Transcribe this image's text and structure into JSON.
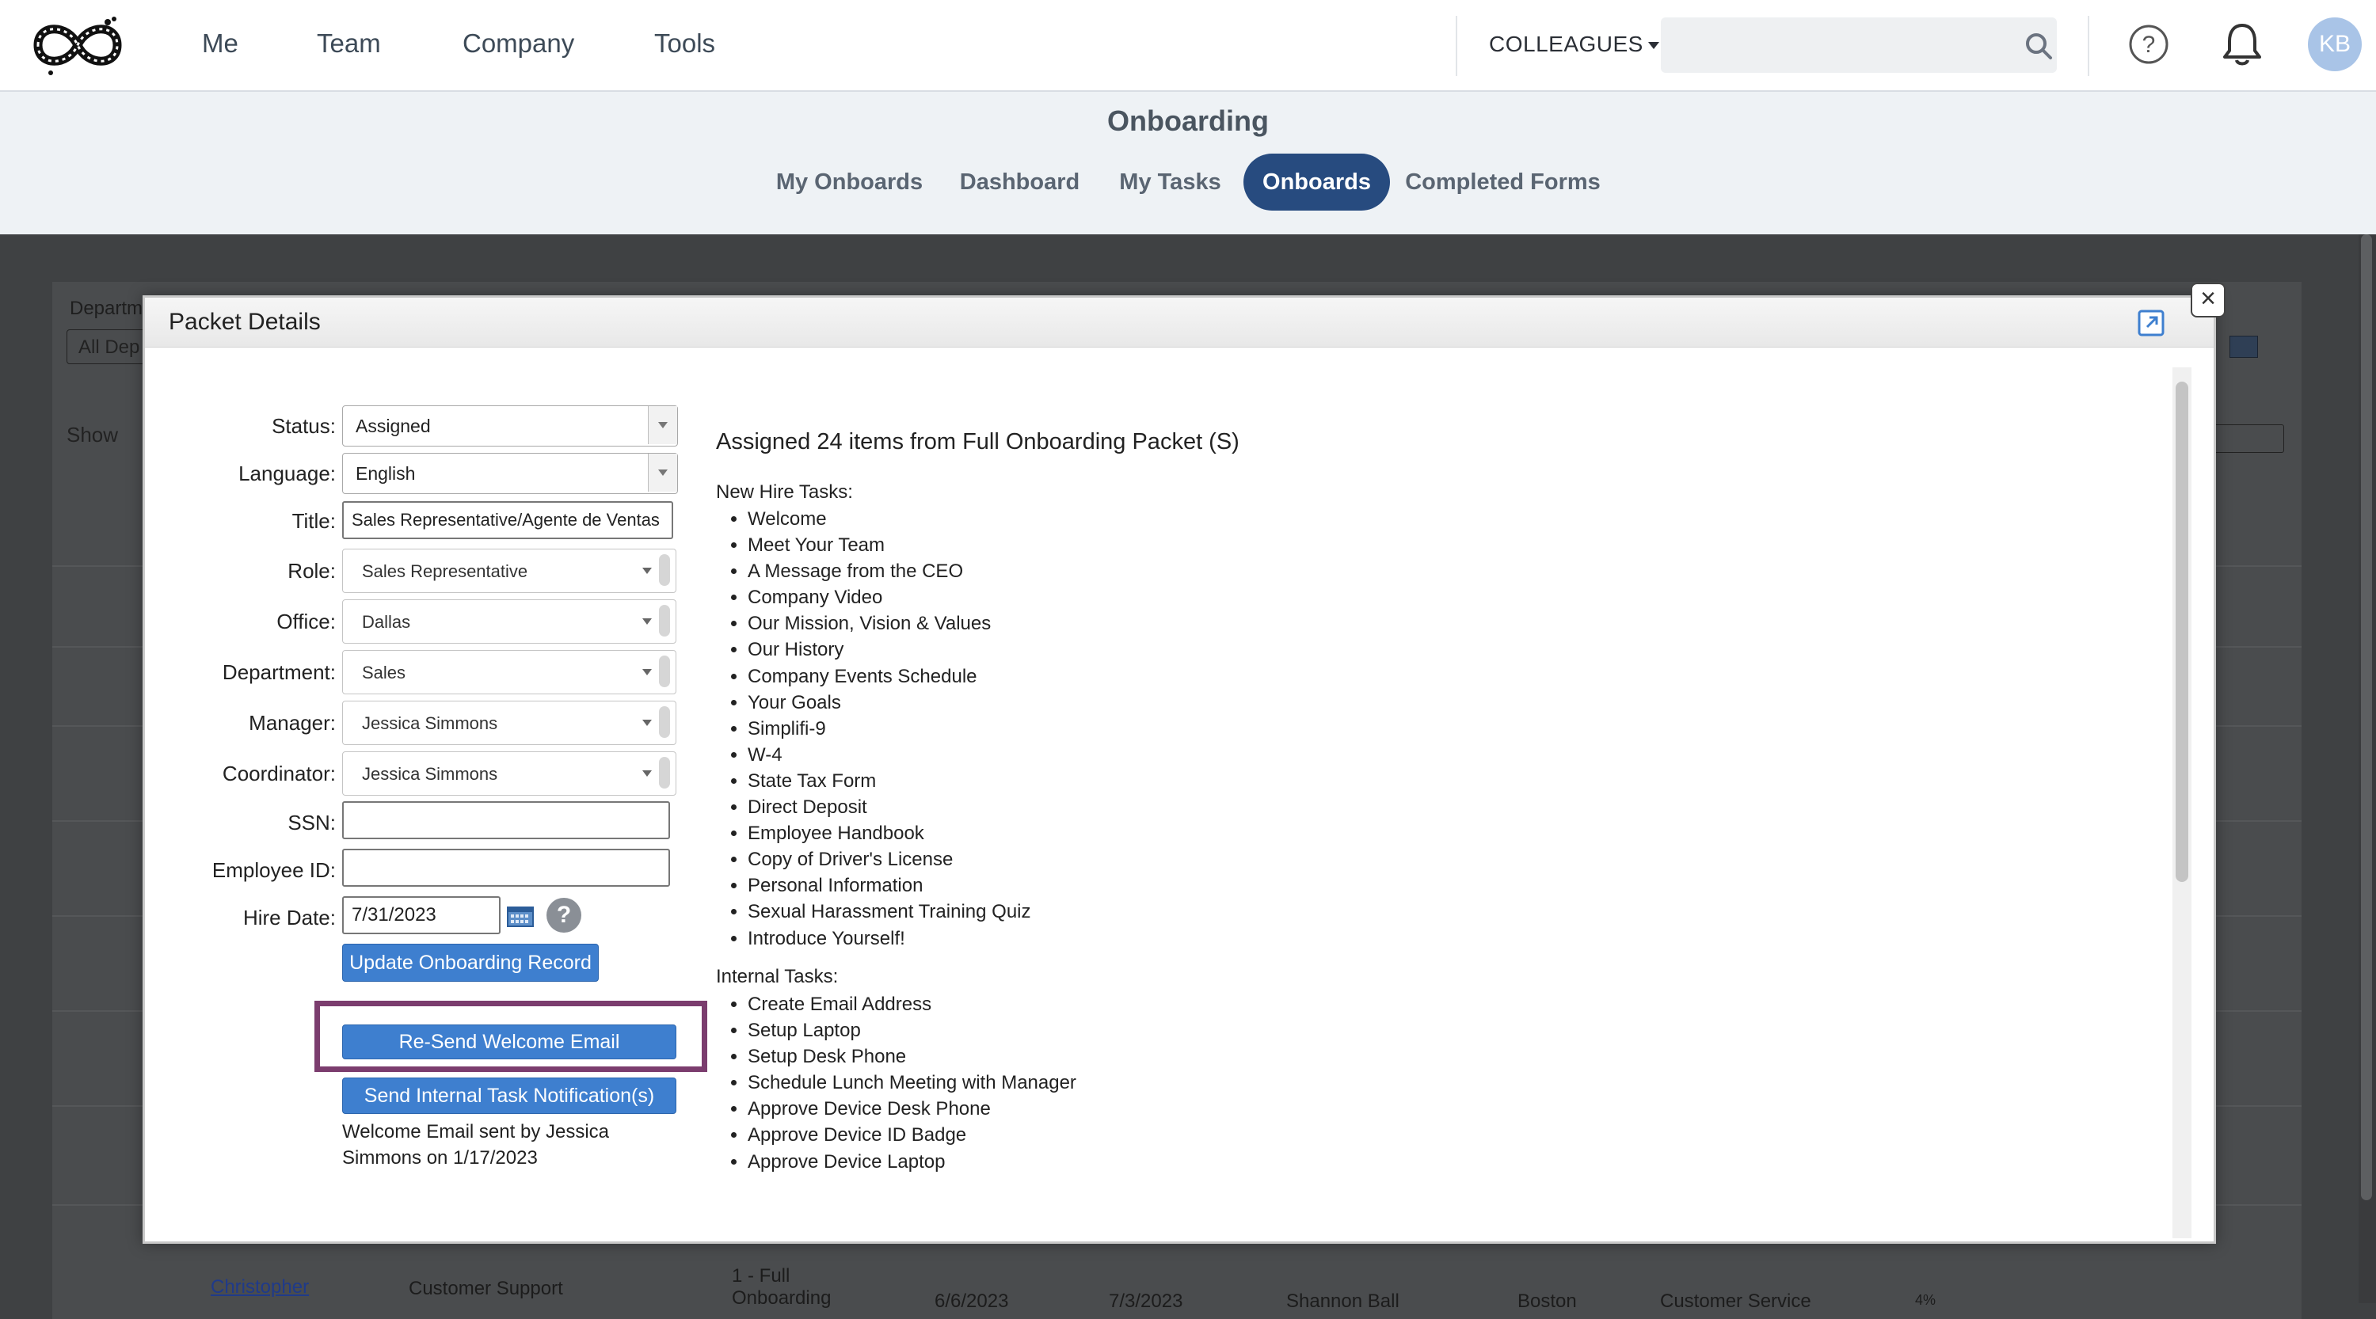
{
  "nav": {
    "links": [
      "Me",
      "Team",
      "Company",
      "Tools"
    ],
    "colleagues_label": "COLLEAGUES",
    "search_placeholder": "",
    "avatar_initials": "KB"
  },
  "page": {
    "title": "Onboarding",
    "tabs": [
      "My Onboards",
      "Dashboard",
      "My Tasks",
      "Onboards",
      "Completed Forms"
    ],
    "active_tab": "Onboards"
  },
  "background": {
    "filter_label": "Departm",
    "filter_value": "All Dep",
    "show_label": "Show",
    "row_name": "Christopher",
    "row_department": "Customer Support",
    "row_packet": "1 - Full Onboarding",
    "row_start": "6/6/2023",
    "row_end": "7/3/2023",
    "row_coordinator": "Shannon Ball",
    "row_office": "Boston",
    "row_role": "Customer Service",
    "row_progress": "4%"
  },
  "modal": {
    "title": "Packet Details",
    "fields": {
      "status_label": "Status:",
      "status_value": "Assigned",
      "language_label": "Language:",
      "language_value": "English",
      "title_label": "Title:",
      "title_value": "Sales Representative/Agente de Ventas",
      "role_label": "Role:",
      "role_value": "Sales Representative",
      "office_label": "Office:",
      "office_value": "Dallas",
      "department_label": "Department:",
      "department_value": "Sales",
      "manager_label": "Manager:",
      "manager_value": "Jessica Simmons",
      "coordinator_label": "Coordinator:",
      "coordinator_value": "Jessica Simmons",
      "ssn_label": "SSN:",
      "ssn_value": "",
      "employee_id_label": "Employee ID:",
      "employee_id_value": "",
      "hire_date_label": "Hire Date:",
      "hire_date_value": "7/31/2023"
    },
    "buttons": {
      "update": "Update Onboarding Record",
      "resend": "Re-Send Welcome Email",
      "notify": "Send Internal Task Notification(s)"
    },
    "sent_note": "Welcome Email sent by Jessica Simmons on 1/17/2023",
    "summary": "Assigned 24 items from Full Onboarding Packet (S)",
    "new_hire_heading": "New Hire Tasks:",
    "new_hire_tasks": [
      "Welcome",
      "Meet Your Team",
      "A Message from the CEO",
      "Company Video",
      "Our Mission, Vision & Values",
      "Our History",
      "Company Events Schedule",
      "Your Goals",
      "Simplifi-9",
      "W-4",
      "State Tax Form",
      "Direct Deposit",
      "Employee Handbook",
      "Copy of Driver's License",
      "Personal Information",
      "Sexual Harassment Training Quiz",
      "Introduce Yourself!"
    ],
    "internal_heading": "Internal Tasks:",
    "internal_tasks": [
      "Create Email Address",
      "Setup Laptop",
      "Setup Desk Phone",
      "Schedule Lunch Meeting with Manager",
      "Approve Device Desk Phone",
      "Approve Device ID Badge",
      "Approve Device Laptop"
    ]
  },
  "colors": {
    "active_tab_bg": "#274b7f",
    "button_blue": "#3e7fcf",
    "highlight_border": "#7b3d6e",
    "overlay": "#3f4143"
  }
}
